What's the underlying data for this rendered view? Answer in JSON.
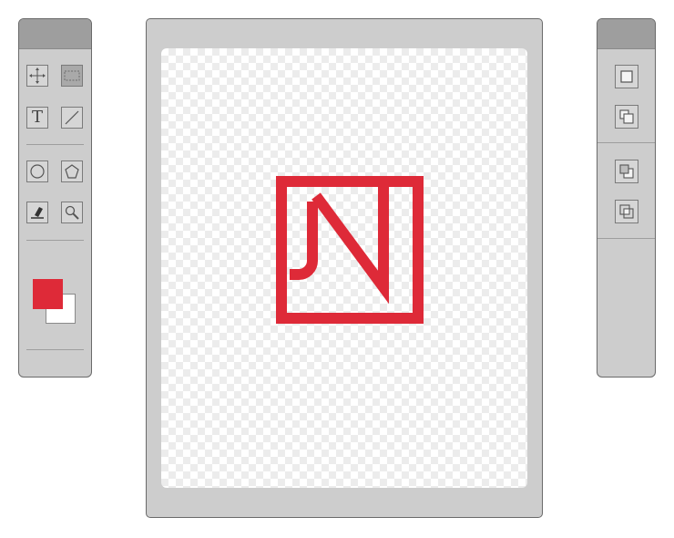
{
  "colors": {
    "accent": "#de2a38",
    "panel": "#cdcdcd",
    "panel_header": "#9e9e9e",
    "foreground_swatch": "#de2a38",
    "background_swatch": "#ffffff"
  },
  "left_toolbar": {
    "tools": [
      {
        "icon": "move-icon",
        "active": false
      },
      {
        "icon": "marquee-select-icon",
        "active": true
      },
      {
        "icon": "text-icon",
        "label": "T",
        "active": false
      },
      {
        "icon": "line-icon",
        "active": false
      },
      {
        "icon": "ellipse-icon",
        "active": false
      },
      {
        "icon": "polygon-icon",
        "active": false
      },
      {
        "icon": "eraser-icon",
        "active": false
      },
      {
        "icon": "zoom-icon",
        "active": false
      }
    ]
  },
  "right_toolbar": {
    "tools": [
      {
        "icon": "square-shape-icon"
      },
      {
        "icon": "union-icon"
      },
      {
        "icon": "subtract-icon"
      },
      {
        "icon": "intersect-icon"
      }
    ]
  },
  "canvas": {
    "background": "transparent-checkerboard",
    "logo": {
      "monogram": "JN",
      "color": "#de2a38"
    }
  }
}
